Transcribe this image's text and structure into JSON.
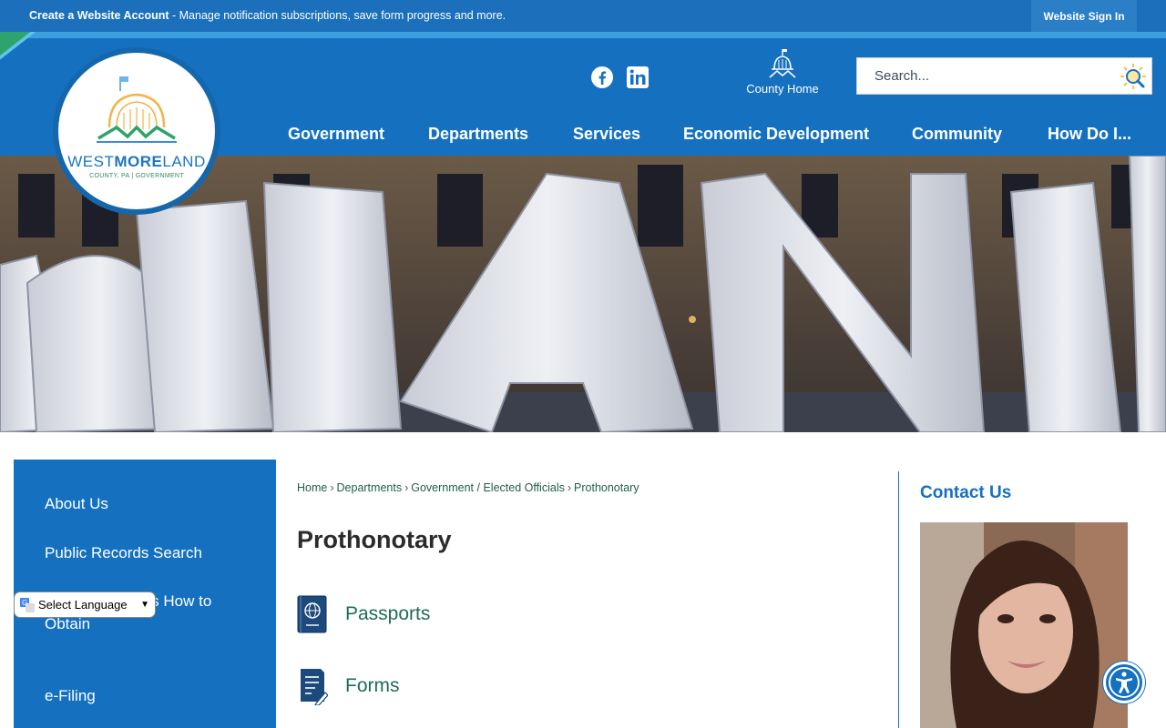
{
  "topbar": {
    "account_link": "Create a Website Account",
    "account_message": " - Manage notification subscriptions, save form progress and more.",
    "signin_label": "Website Sign In"
  },
  "header": {
    "logo": {
      "word_light": "WEST",
      "word_bold": "MORE",
      "word_end": "LAND",
      "subtitle": "COUNTY, PA | GOVERNMENT"
    },
    "social": [
      "facebook-icon",
      "linkedin-icon"
    ],
    "county_home_label": "County Home",
    "search": {
      "placeholder": "Search..."
    },
    "nav": [
      "Government",
      "Departments",
      "Services",
      "Economic Development",
      "Community",
      "How Do I..."
    ]
  },
  "sidebar": {
    "items": [
      "About Us",
      "Public Records Search",
      "...e - Instructions How to Obtain",
      "e-Filing"
    ],
    "language_select": "Select Language"
  },
  "main": {
    "breadcrumb": [
      "Home",
      "Departments",
      "Government / Elected Officials",
      "Prothonotary"
    ],
    "title": "Prothonotary",
    "quicklinks": [
      {
        "label": "Passports",
        "icon": "passport-icon"
      },
      {
        "label": "Forms",
        "icon": "form-icon"
      }
    ]
  },
  "contact": {
    "title": "Contact Us"
  },
  "colors": {
    "brand_blue": "#1571c0",
    "green_link": "#1e6b5a"
  }
}
